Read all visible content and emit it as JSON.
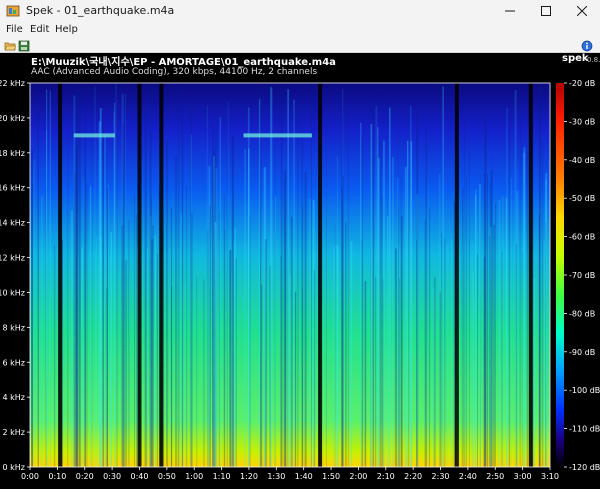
{
  "window": {
    "title": "Spek - 01_earthquake.m4a",
    "controls": [
      "minimize-icon",
      "maximize-icon",
      "close-icon"
    ]
  },
  "menu": {
    "items": [
      "File",
      "Edit",
      "Help"
    ]
  },
  "toolbar": {
    "open_icon": "folder-open-icon",
    "save_icon": "save-icon",
    "about_icon": "info-icon"
  },
  "header": {
    "file_path": "E:\\Muuzik\\국내\\지수\\EP - AMORTAGE\\01_earthquake.m4a",
    "file_info": "AAC (Advanced Audio Coding), 320 kbps, 44100 Hz, 2 channels",
    "brand": "spek",
    "version": "0.8.2"
  },
  "chart_data": {
    "type": "heatmap",
    "title": "",
    "y_axis": {
      "unit": "kHz",
      "range": [
        0,
        22
      ],
      "ticks": [
        "22 kHz",
        "20 kHz",
        "18 kHz",
        "16 kHz",
        "14 kHz",
        "12 kHz",
        "10 kHz",
        "8 kHz",
        "6 kHz",
        "4 kHz",
        "2 kHz",
        "0 kHz"
      ]
    },
    "x_axis": {
      "unit": "time",
      "range": [
        "0:00",
        "3:10"
      ],
      "ticks": [
        "0:00",
        "0:10",
        "0:20",
        "0:30",
        "0:40",
        "0:50",
        "1:00",
        "1:10",
        "1:20",
        "1:30",
        "1:40",
        "1:50",
        "2:00",
        "2:10",
        "2:20",
        "2:30",
        "2:40",
        "2:50",
        "3:00",
        "3:10"
      ]
    },
    "color_scale": {
      "unit": "dB",
      "range": [
        -120,
        -20
      ],
      "ticks": [
        "-20 dB",
        "-30 dB",
        "-40 dB",
        "-50 dB",
        "-60 dB",
        "-70 dB",
        "-80 dB",
        "-90 dB",
        "-100 dB",
        "-110 dB",
        "-120 dB"
      ],
      "colors": [
        "#b40000",
        "#ff2000",
        "#ff8000",
        "#ffd800",
        "#c8ff00",
        "#40ff40",
        "#00ffc8",
        "#00a0ff",
        "#0030ff",
        "#1a0080",
        "#000000"
      ]
    },
    "silent_gaps_seconds": [
      11,
      40,
      48,
      106,
      156,
      183
    ],
    "tone_band_khz": 19
  },
  "colors": {
    "background": "#000000",
    "chrome": "#f3f3f3"
  }
}
